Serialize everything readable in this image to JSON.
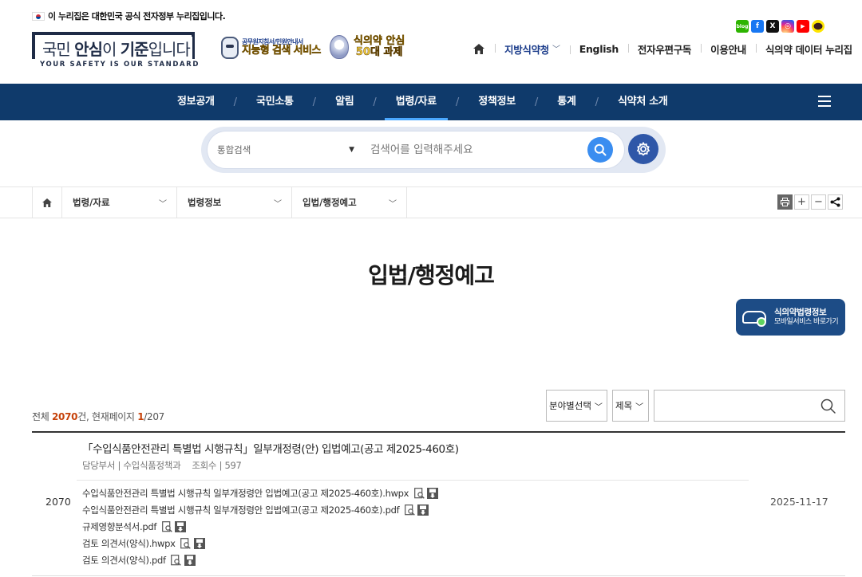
{
  "gov_banner": "이 누리집은 대한민국 공식 전자정부 누리집입니다.",
  "logo": {
    "text_pre": "국민 ",
    "text_bold1": "안심",
    "text_mid": "이 ",
    "text_bold2": "기준",
    "text_post": "입니다",
    "sub": "YOUR SAFETY IS OUR STANDARD"
  },
  "promo1": {
    "small": "공무원지침서/민원안내서",
    "big": "지능형 검색 서비스"
  },
  "promo2": {
    "line1": "식의약 안심",
    "line2": "50대 과제"
  },
  "sns": {
    "blog": "blog",
    "facebook": "f",
    "x": "X",
    "instagram": "◎",
    "youtube": "▶",
    "kakao": "talk"
  },
  "util": {
    "local": "지방식약청",
    "english": "English",
    "newsletter": "전자우편구독",
    "guide": "이용안내",
    "data": "식의약 데이터 누리집"
  },
  "gnb": {
    "items": [
      "정보공개",
      "국민소통",
      "알림",
      "법령/자료",
      "정책정보",
      "통계",
      "식약처 소개"
    ],
    "separator": "/",
    "active_index": 3
  },
  "search": {
    "scope": "통합검색",
    "placeholder": "검색어를 입력해주세요"
  },
  "location": {
    "level1": "법령/자료",
    "level2": "법령정보",
    "level3": "입법/행정예고"
  },
  "tools": {
    "plus": "+",
    "minus": "−"
  },
  "page_title": "입법/행정예고",
  "mobile_banner": {
    "line1": "식의약법령정보",
    "line2": "모바일서비스 바로가기"
  },
  "board": {
    "total_label": "전체 ",
    "total_count": "2070",
    "total_suffix": "건, 현재페이지 ",
    "current_page": "1",
    "total_pages": "/207",
    "filter_category": "분야별선택",
    "filter_field": "제목",
    "search_value": ""
  },
  "post": {
    "number": "2070",
    "title": "「수입식품안전관리 특별법 시행규칙」일부개정령(안) 입법예고(공고 제2025-460호)",
    "dept_label": "담당부서 | ",
    "dept": "수입식품정책과",
    "views_label": "조회수 | ",
    "views": "597",
    "date": "2025-11-17",
    "files": [
      "수입식품안전관리 특별법 시행규칙 일부개정령안 입법예고(공고 제2025-460호).hwpx",
      "수입식품안전관리 특별법 시행규칙 일부개정령안 입법예고(공고 제2025-460호).pdf",
      "규제영향분석서.pdf",
      "검토 의견서(양식).hwpx",
      "검토 의견서(양식).pdf"
    ]
  },
  "colors": {
    "navy": "#0f3a6b",
    "accent_blue": "#3a8df0",
    "gear_blue": "#2f57a8",
    "highlight_orange": "#c6420a",
    "active_underline": "#4aa8ff"
  }
}
